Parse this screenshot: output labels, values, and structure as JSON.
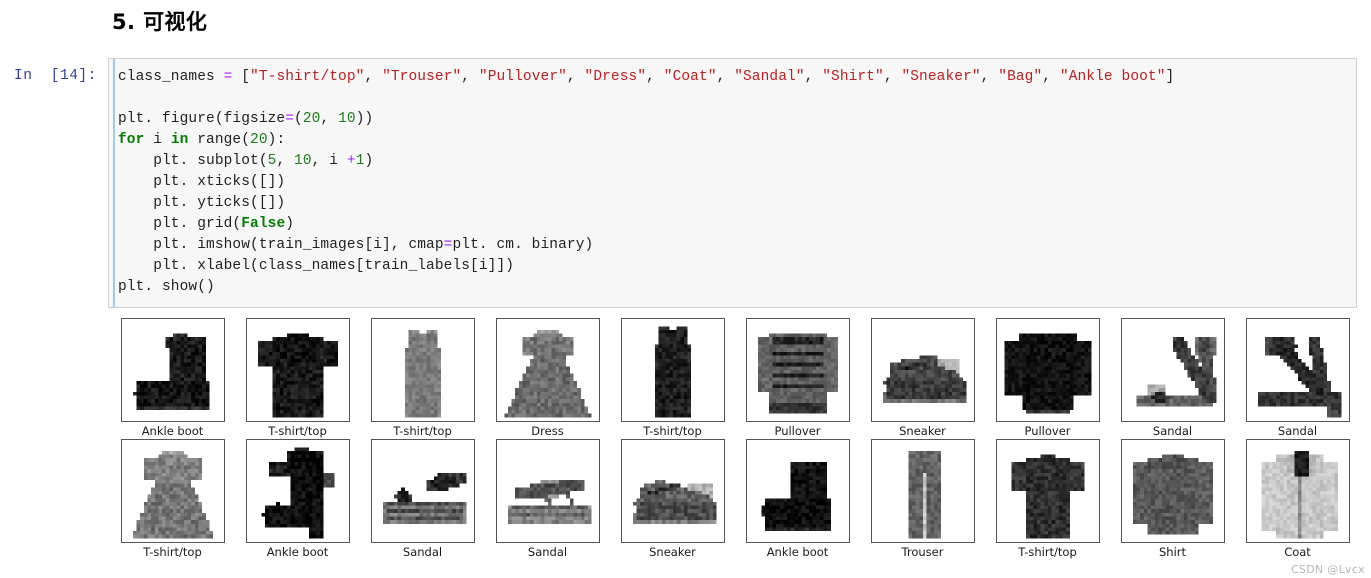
{
  "heading": "5. 可视化",
  "notebook": {
    "prompt_label": "In  [14]:",
    "prompt_color": "#303f9f",
    "cell_background": "#f7f7f7",
    "code_lines": [
      "class_names = [\"T-shirt/top\", \"Trouser\", \"Pullover\", \"Dress\", \"Coat\", \"Sandal\", \"Shirt\", \"Sneaker\", \"Bag\", \"Ankle boot\"]",
      "",
      "plt. figure(figsize=(20, 10))",
      "for i in range(20):",
      "    plt. subplot(5, 10, i +1)",
      "    plt. xticks([])",
      "    plt. yticks([])",
      "    plt. grid(False)",
      "    plt. imshow(train_images[i], cmap=plt. cm. binary)",
      "    plt. xlabel(class_names[train_labels[i]])",
      "plt. show()"
    ],
    "class_names": [
      "T-shirt/top",
      "Trouser",
      "Pullover",
      "Dress",
      "Coat",
      "Sandal",
      "Shirt",
      "Sneaker",
      "Bag",
      "Ankle boot"
    ]
  },
  "figure": {
    "rows": [
      [
        {
          "label": "Ankle boot",
          "kind": "ankle-boot-high"
        },
        {
          "label": "T-shirt/top",
          "kind": "tshirt-print"
        },
        {
          "label": "T-shirt/top",
          "kind": "tank-light"
        },
        {
          "label": "Dress",
          "kind": "dress-grey"
        },
        {
          "label": "T-shirt/top",
          "kind": "tank-dark"
        },
        {
          "label": "Pullover",
          "kind": "pullover-striped"
        },
        {
          "label": "Sneaker",
          "kind": "sneaker-low"
        },
        {
          "label": "Pullover",
          "kind": "pullover-dark"
        },
        {
          "label": "Sandal",
          "kind": "sandal-heel"
        },
        {
          "label": "Sandal",
          "kind": "sandal-heel2"
        }
      ],
      [
        {
          "label": "T-shirt/top",
          "kind": "dress-grey2"
        },
        {
          "label": "Ankle boot",
          "kind": "ankle-boot-heel"
        },
        {
          "label": "Sandal",
          "kind": "sandal-flat"
        },
        {
          "label": "Sandal",
          "kind": "sandal-flat2"
        },
        {
          "label": "Sneaker",
          "kind": "sneaker-low2"
        },
        {
          "label": "Ankle boot",
          "kind": "ankle-boot-dark"
        },
        {
          "label": "Trouser",
          "kind": "trouser"
        },
        {
          "label": "T-shirt/top",
          "kind": "tshirt-dark"
        },
        {
          "label": "Shirt",
          "kind": "shirt-grey"
        },
        {
          "label": "Coat",
          "kind": "coat-light"
        }
      ]
    ]
  },
  "watermark": "CSDN @Lvcx"
}
